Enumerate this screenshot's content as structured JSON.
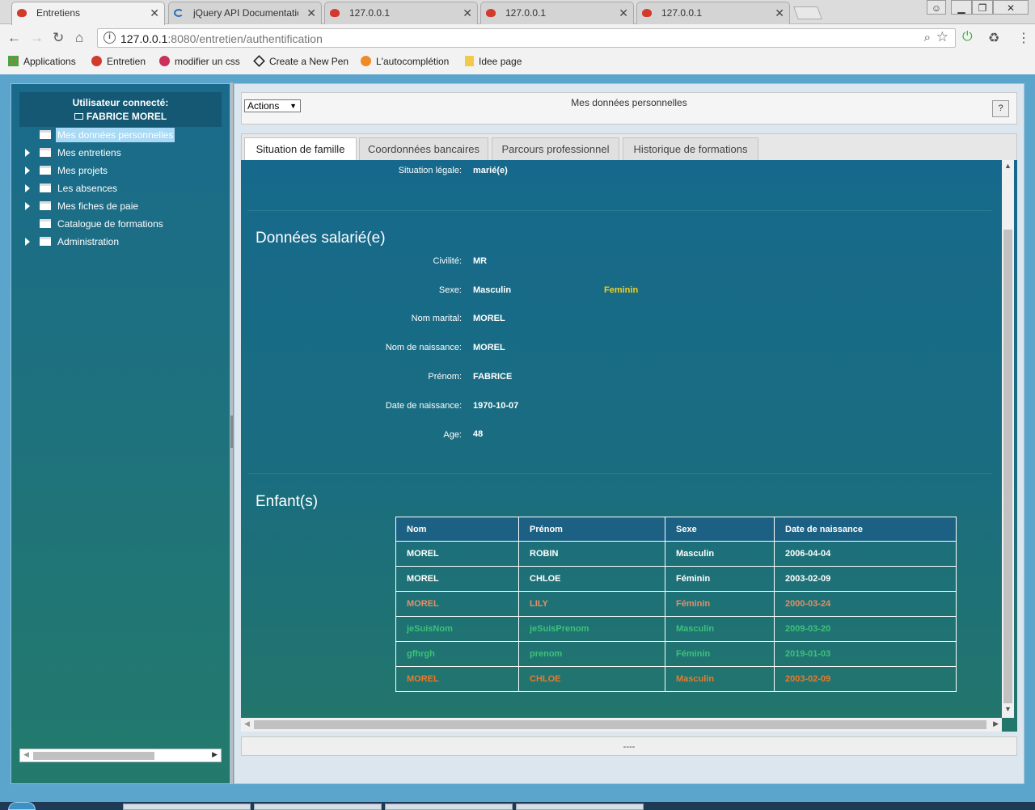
{
  "browser": {
    "tabs": [
      {
        "title": "Entretiens",
        "icon": "speech-bubble-icon",
        "active": true
      },
      {
        "title": "jQuery API Documentatic",
        "icon": "jquery-icon",
        "active": false
      },
      {
        "title": "127.0.0.1",
        "icon": "speech-bubble-icon",
        "active": false
      },
      {
        "title": "127.0.0.1",
        "icon": "speech-bubble-icon",
        "active": false
      },
      {
        "title": "127.0.0.1",
        "icon": "speech-bubble-icon",
        "active": false
      }
    ],
    "url_host": "127.0.0.1",
    "url_rest": ":8080/entretien/authentification",
    "bookmarks": [
      {
        "label": "Applications",
        "icon": "apps-grid-icon"
      },
      {
        "label": "Entretien",
        "icon": "speech-bubble-icon"
      },
      {
        "label": "modifier un css",
        "icon": "vo-icon"
      },
      {
        "label": "Create a New Pen",
        "icon": "codepen-icon"
      },
      {
        "label": "L'autocomplétion",
        "icon": "autocompletion-icon"
      },
      {
        "label": "Idee page",
        "icon": "folder-icon"
      }
    ],
    "colors": {
      "accent_red": "#d23a2c",
      "ext_green": "#3cb03c"
    }
  },
  "sidebar": {
    "user_heading": "Utilisateur connecté:",
    "user_name": "FABRICE MOREL",
    "items": [
      {
        "label": "Mes données personnelles",
        "expandable": false,
        "selected": true
      },
      {
        "label": "Mes entretiens",
        "expandable": true,
        "selected": false
      },
      {
        "label": "Mes projets",
        "expandable": true,
        "selected": false
      },
      {
        "label": "Les absences",
        "expandable": true,
        "selected": false
      },
      {
        "label": "Mes fiches de paie",
        "expandable": true,
        "selected": false
      },
      {
        "label": "Catalogue de formations",
        "expandable": false,
        "selected": false
      },
      {
        "label": "Administration",
        "expandable": true,
        "selected": false
      }
    ]
  },
  "main": {
    "title": "Mes données personnelles",
    "actions_label": "Actions",
    "help_label": "?",
    "tabs": [
      {
        "label": "Situation de famille",
        "active": true
      },
      {
        "label": "Coordonnées bancaires",
        "active": false
      },
      {
        "label": "Parcours professionnel",
        "active": false
      },
      {
        "label": "Historique de formations",
        "active": false
      }
    ],
    "situation": {
      "label": "Situation légale:",
      "value": "marié(e)"
    },
    "salarie": {
      "heading": "Données salarié(e)",
      "civilite": {
        "label": "Civilité:",
        "value": "MR"
      },
      "sexe": {
        "label": "Sexe:",
        "value": "Masculin",
        "alt": "Feminin"
      },
      "nom_marital": {
        "label": "Nom marital:",
        "value": "MOREL"
      },
      "nom_naissance": {
        "label": "Nom de naissance:",
        "value": "MOREL"
      },
      "prenom": {
        "label": "Prénom:",
        "value": "FABRICE"
      },
      "date_naissance": {
        "label": "Date de naissance:",
        "value": "1970-10-07"
      },
      "age": {
        "label": "Age:",
        "value": "48"
      }
    },
    "enfants": {
      "heading": "Enfant(s)",
      "columns": [
        "Nom",
        "Prénom",
        "Sexe",
        "Date de naissance"
      ],
      "rows": [
        {
          "cells": [
            "MOREL",
            "ROBIN",
            "Masculin",
            "2006-04-04"
          ],
          "color": "#ffffff"
        },
        {
          "cells": [
            "MOREL",
            "CHLOE",
            "Féminin",
            "2003-02-09"
          ],
          "color": "#ffffff"
        },
        {
          "cells": [
            "MOREL",
            "LILY",
            "Féminin",
            "2000-03-24"
          ],
          "color": "#e0906a"
        },
        {
          "cells": [
            "jeSuisNom",
            "jeSuisPrenom",
            "Masculin",
            "2009-03-20"
          ],
          "color": "#3cc27a"
        },
        {
          "cells": [
            "gfhrgh",
            "prenom",
            "Féminin",
            "2019-01-03"
          ],
          "color": "#3cc27a"
        },
        {
          "cells": [
            "MOREL",
            "CHLOE",
            "Masculin",
            "2003-02-09"
          ],
          "color": "#e87a2c"
        }
      ]
    },
    "footer": "----",
    "colors": {
      "highlight_yellow": "#f0d020"
    }
  }
}
